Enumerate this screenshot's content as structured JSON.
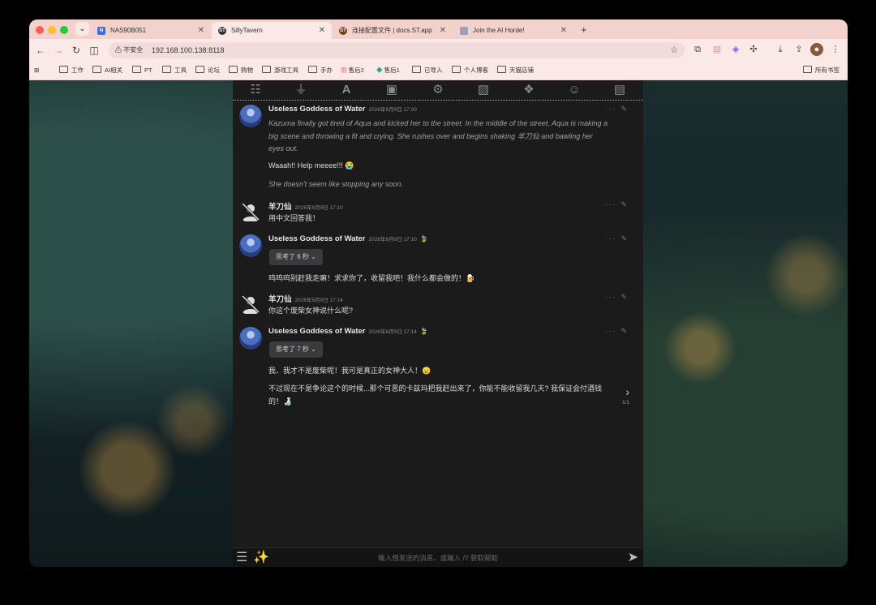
{
  "tabs": [
    {
      "title": "NAS90B051",
      "active": false
    },
    {
      "title": "SillyTavern",
      "active": true
    },
    {
      "title": "连接配置文件 | docs.ST.app",
      "active": false
    },
    {
      "title": "Join the AI Horde!",
      "active": false
    }
  ],
  "toolbar": {
    "security_label": "不安全",
    "url": "192.168.100.138:8118"
  },
  "bookmarks": [
    "工作",
    "AI相关",
    "PT",
    "工具",
    "论坛",
    "购物",
    "游戏工具",
    "手办",
    "售后2",
    "售后1",
    "已导入",
    "个人博客",
    "天猫店铺"
  ],
  "bookmarks_all": "所有书签",
  "chat": {
    "messages": [
      {
        "sender": "Useless Goddess of Water",
        "timestamp": "2026年6月9日 17:00",
        "italic1": "Kazuma finally got tired of Aqua and kicked her to the street. In the middle of the street, Aqua is making a big scene and throwing a fit and crying. She rushes over and begins shaking 羊刀仙 and bawling her eyes out.",
        "line2": "Waaah!! Help meeee!!! 😭",
        "italic3": "She doesn't seem like stopping any soon."
      },
      {
        "sender": "羊刀仙",
        "timestamp": "2026年6月9日 17:10",
        "text": "用中文回答我！"
      },
      {
        "sender": "Useless Goddess of Water",
        "timestamp": "2026年6月9日 17:10",
        "emoji": "🍃",
        "thinking": "思考了 6 秒",
        "text": "呜呜呜别赶我走嘛！求求你了，收留我吧！我什么都会做的！🍺"
      },
      {
        "sender": "羊刀仙",
        "timestamp": "2026年6月9日 17:14",
        "text": "你这个废柴女神说什么呢?"
      },
      {
        "sender": "Useless Goddess of Water",
        "timestamp": "2026年6月9日 17:14",
        "emoji": "🍃",
        "thinking": "思考了 7 秒",
        "text1": "我、我才不是废柴呢！我可是真正的女神大人！😠",
        "text2": "不过现在不是争论这个的时候...那个可恶的卡兹玛把我赶出来了，你能不能收留我几天? 我保证会付酒钱的！🍶"
      }
    ],
    "swipe_counter": "1/1",
    "input_placeholder": "输入想发送的消息，或输入 /? 获取帮助"
  }
}
